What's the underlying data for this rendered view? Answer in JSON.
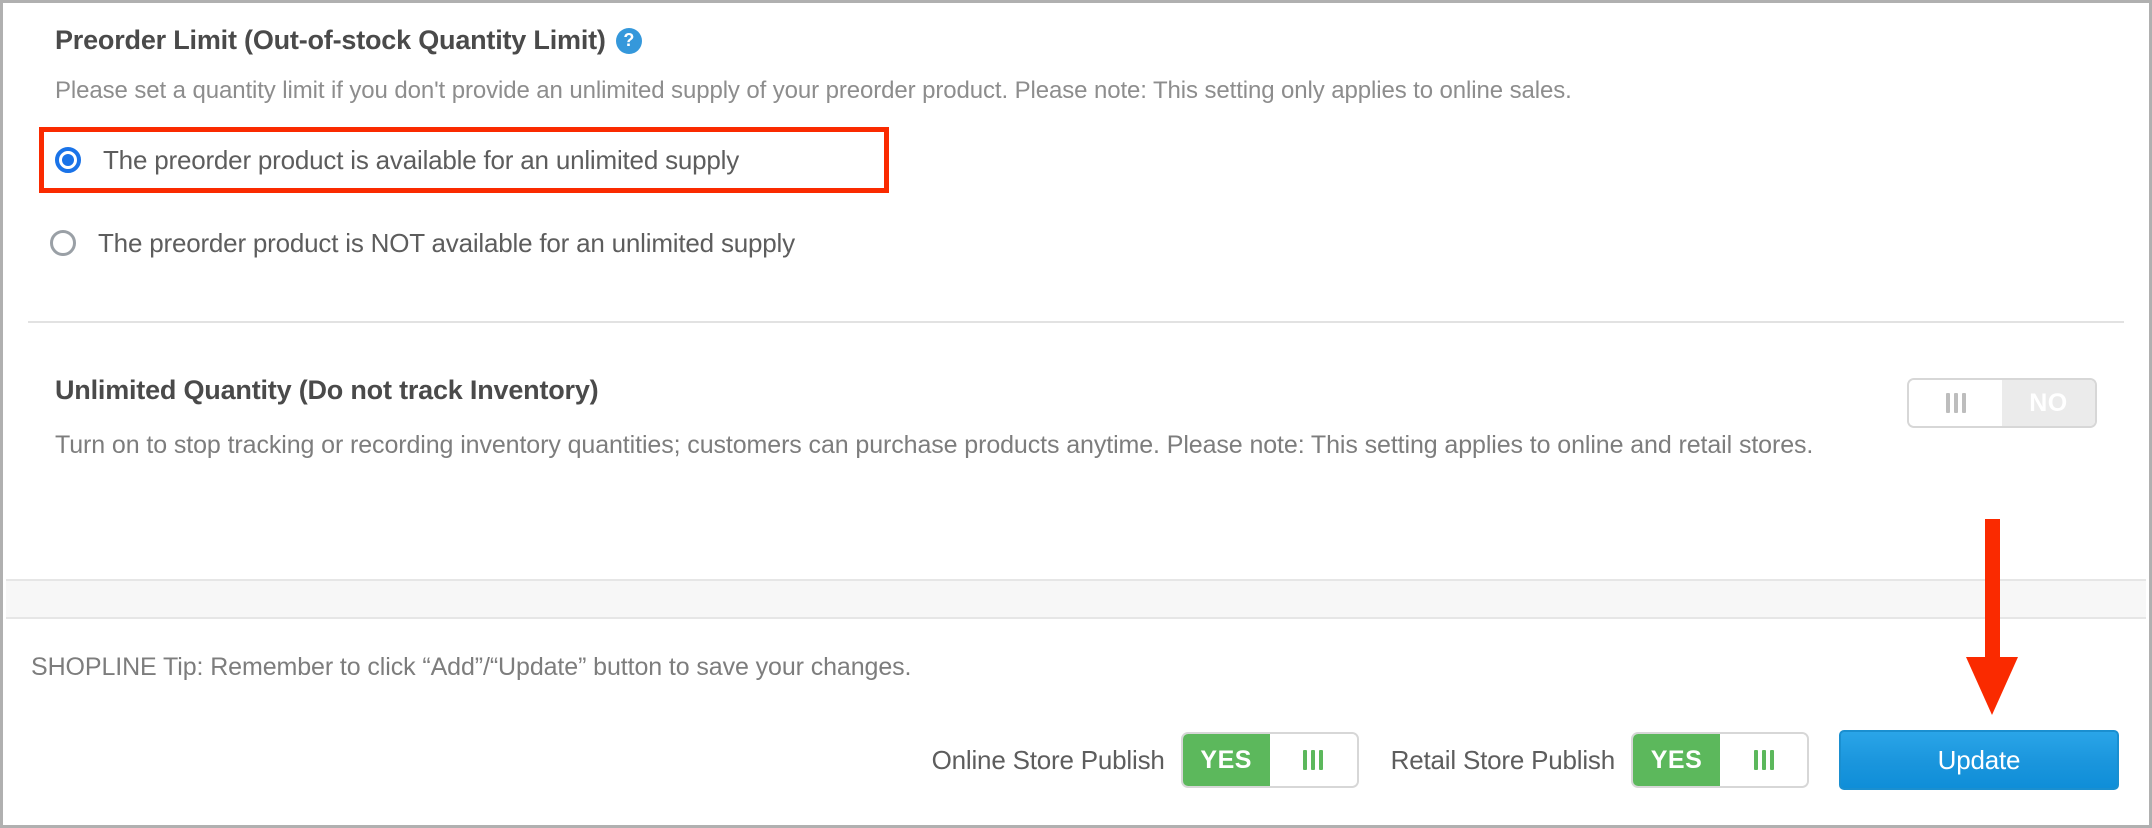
{
  "preorder_section": {
    "title": "Preorder Limit (Out-of-stock Quantity Limit)",
    "help_icon": "question-mark-circle-icon",
    "description": "Please set a quantity limit if you don't provide an unlimited supply of your preorder product. Please note: This setting only applies to online sales.",
    "options": [
      {
        "label": "The preorder product is available for an unlimited supply",
        "selected": true,
        "highlighted": true
      },
      {
        "label": "The preorder product is NOT available for an unlimited supply",
        "selected": false,
        "highlighted": false
      }
    ]
  },
  "unlimited_section": {
    "title": "Unlimited Quantity (Do not track Inventory)",
    "description": "Turn on to stop tracking or recording inventory quantities; customers can purchase products anytime. Please note: This setting applies to online and retail stores.",
    "toggle": {
      "state_label": "NO",
      "grip_icon": "grip-lines-icon",
      "on": false
    }
  },
  "footer": {
    "tip": "SHOPLINE Tip: Remember to click “Add”/“Update” button to save your changes.",
    "online_store_publish": {
      "label": "Online Store Publish",
      "state_label": "YES",
      "grip_icon": "grip-lines-icon",
      "on": true
    },
    "retail_store_publish": {
      "label": "Retail Store Publish",
      "state_label": "YES",
      "grip_icon": "grip-lines-icon",
      "on": true
    },
    "update_button": "Update"
  },
  "annotations": {
    "highlight_box_color": "#fa2a00",
    "arrow_color": "#fa2a00",
    "arrow_icon": "down-arrow-icon",
    "arrow_target": "Update"
  },
  "colors": {
    "accent_blue": "#3598db",
    "button_blue": "#1b96dd",
    "toggle_green": "#5cb85c",
    "radio_blue": "#1a73e8",
    "annotation_red": "#fa2a00",
    "text_dark": "#4a4a4a",
    "text_muted": "#8d8d8d"
  }
}
